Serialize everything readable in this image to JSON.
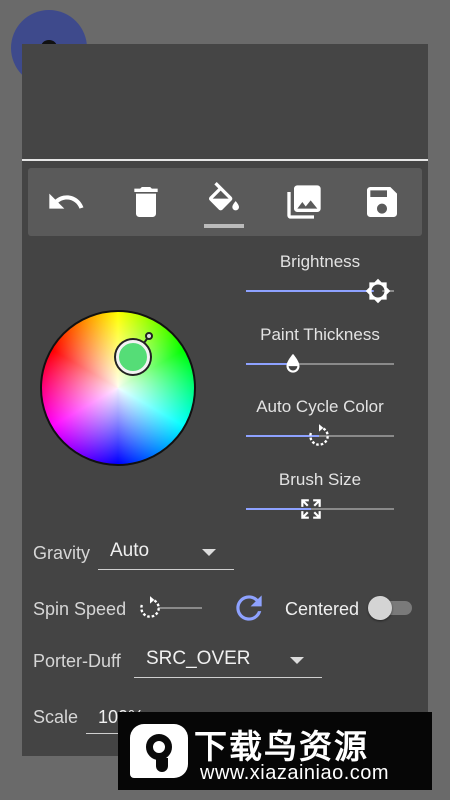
{
  "toolbar": {
    "tools": [
      {
        "icon": "undo-icon"
      },
      {
        "icon": "trash-icon"
      },
      {
        "icon": "paint-bucket-icon",
        "active": true
      },
      {
        "icon": "image-gallery-icon"
      },
      {
        "icon": "save-icon"
      }
    ]
  },
  "color_wheel": {
    "selected_color": "#55dd77"
  },
  "sliders": [
    {
      "label": "Brightness",
      "value": 0.89,
      "thumb_icon": "brightness-icon"
    },
    {
      "label": "Paint Thickness",
      "value": 0.32,
      "thumb_icon": "drop-icon"
    },
    {
      "label": "Auto Cycle Color",
      "value": 0.49,
      "thumb_icon": "cycle-icon"
    },
    {
      "label": "Brush Size",
      "value": 0.44,
      "thumb_icon": "expand-arrows-icon"
    }
  ],
  "gravity": {
    "label": "Gravity",
    "value": "Auto"
  },
  "spin_speed": {
    "label": "Spin Speed",
    "value": 0.0
  },
  "centered": {
    "label": "Centered",
    "checked": false
  },
  "porter_duff": {
    "label": "Porter-Duff",
    "value": "SRC_OVER"
  },
  "scale": {
    "label": "Scale",
    "value": "100%"
  },
  "watermark": {
    "title": "下载鸟资源",
    "url": "www.xiazainiao.com"
  },
  "colors": {
    "accent": "#8ea2ff",
    "panel": "#444444",
    "toolbar": "#5a5a5a",
    "background": "#6a6a6a"
  }
}
